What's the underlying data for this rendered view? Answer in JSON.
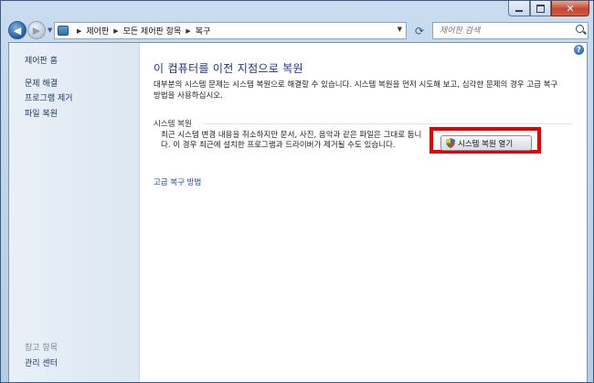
{
  "window": {
    "controls": {
      "minimize": "minimize",
      "maximize": "maximize",
      "close": "close"
    }
  },
  "address": {
    "breadcrumbs": [
      "제어판",
      "모든 제어판 항목",
      "복구"
    ],
    "search_placeholder": "제어판 검색"
  },
  "sidebar": {
    "home": "제어판 홈",
    "items": [
      "문제 해결",
      "프로그램 제거",
      "파일 복원"
    ],
    "see_also_heading": "참고 항목",
    "see_also_items": [
      "관리 센터"
    ]
  },
  "main": {
    "title": "이 컴퓨터를 이전 지점으로 복원",
    "description": "대부분의 시스템 문제는 시스템 복원으로 해결할 수 있습니다. 시스템 복원을 먼저 시도해 보고, 심각한 문제의 경우 고급 복구 방법을 사용하십시오.",
    "section_label": "시스템 복원",
    "section_text": "최근 시스템 변경 내용을 취소하지만 문서, 사진, 음악과 같은 파일은 그대로 둡니다. 이 경우 최근에 설치한 프로그램과 드라이버가 제거될 수도 있습니다.",
    "restore_button": "시스템 복원 열기",
    "advanced_link": "고급 복구 방법"
  },
  "colors": {
    "highlight": "#e30000",
    "title": "#1e3287",
    "link": "#1c4aa8"
  }
}
